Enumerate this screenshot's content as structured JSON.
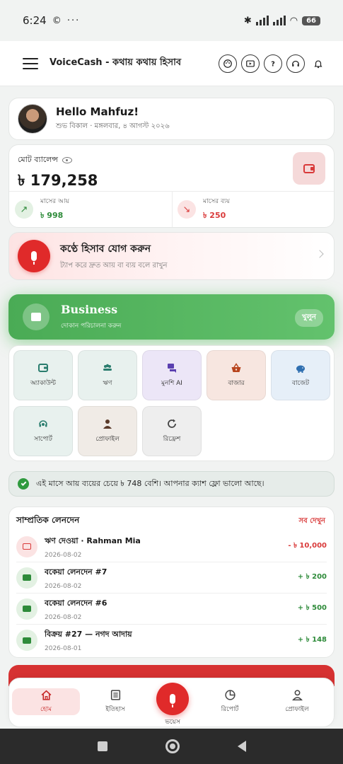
{
  "status_bar": {
    "time": "6:24",
    "left_icons": "© ···",
    "battery": "66"
  },
  "app_bar": {
    "title": "VoiceCash - কথায় কথায় হিসাব",
    "icons": [
      "menu-icon",
      "palette-icon",
      "video-icon",
      "help-icon",
      "support-agent-icon",
      "bell-icon"
    ]
  },
  "greeting": {
    "hello": "Hello Mahfuz!",
    "subtitle": "শুভ বিকাল · মঙ্গলবার, ৪ আগস্ট ২০২৬"
  },
  "balance": {
    "label": "মোট ব্যালেন্স",
    "amount": "৳ 179,258",
    "income_label": "মাসের আয়",
    "income_value": "৳ 998",
    "expense_label": "মাসের ব্যয়",
    "expense_value": "৳ 250"
  },
  "voice": {
    "title": "কণ্ঠে হিসাব যোগ করুন",
    "subtitle": "ট্যাপ করে দ্রুত আয় বা ব্যয় বলে রাখুন"
  },
  "business": {
    "title": "Business",
    "subtitle": "দোকান পরিচালনা করুন",
    "button": "খুলুন"
  },
  "quick_actions": [
    {
      "label": "অ্যাকাউন্ট",
      "icon": "wallet-icon",
      "bg": "#e8f1ee",
      "color": "#2a7d6e"
    },
    {
      "label": "ঋণ",
      "icon": "people-icon",
      "bg": "#e8f1ee",
      "color": "#2a7d6e"
    },
    {
      "label": "মুনশি AI",
      "icon": "chat-icon",
      "bg": "#ece6f7",
      "color": "#5a3fb0"
    },
    {
      "label": "বাজার",
      "icon": "basket-icon",
      "bg": "#f7e6e0",
      "color": "#b8441d"
    },
    {
      "label": "বাজেট",
      "icon": "piggy-bank-icon",
      "bg": "#e6eff8",
      "color": "#2f6fb0"
    },
    {
      "label": "সাপোর্ট",
      "icon": "support-agent-icon",
      "bg": "#e8f1ee",
      "color": "#2a7d6e"
    },
    {
      "label": "প্রোফাইল",
      "icon": "person-icon",
      "bg": "#f0ebe6",
      "color": "#5a3a2a"
    },
    {
      "label": "রিফ্রেশ",
      "icon": "refresh-icon",
      "bg": "#eeeeee",
      "color": "#444444"
    }
  ],
  "notice": "এই মাসে আয় ব্যয়ের চেয়ে ৳ 748 বেশি। আপনার ক্যাশ ফ্লো ভালো আছে।",
  "transactions": {
    "title": "সাম্প্রতিক লেনদেন",
    "view_all": "সব দেখুন",
    "items": [
      {
        "name": "ঋণ দেওয়া · Rahman Mia",
        "date": "2026-08-02",
        "amount": "- ৳ 10,000",
        "type": "out"
      },
      {
        "name": "বকেয়া লেনদেন #7",
        "date": "2026-08-02",
        "amount": "+ ৳ 200",
        "type": "in"
      },
      {
        "name": "বকেয়া লেনদেন #6",
        "date": "2026-08-02",
        "amount": "+ ৳ 500",
        "type": "in"
      },
      {
        "name": "বিক্রয় #27 — নগদ আদায়",
        "date": "2026-08-01",
        "amount": "+ ৳ 148",
        "type": "in"
      }
    ]
  },
  "bottom_nav": {
    "home": "হোম",
    "history": "ইতিহাস",
    "voice": "ভয়েস",
    "report": "রিপোর্ট",
    "profile": "প্রোফাইল"
  },
  "colors": {
    "primary": "#e02a2a",
    "success": "#2e8b3a",
    "business": "#4aab55"
  }
}
